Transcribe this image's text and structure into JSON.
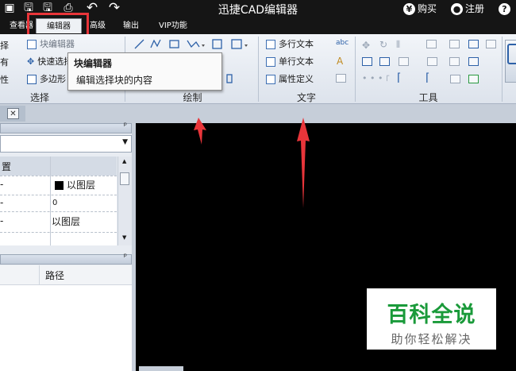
{
  "app": {
    "title": "迅捷CAD编辑器"
  },
  "titlebar": {
    "buy_label": "购买",
    "register_label": "注册",
    "help_glyph": "?",
    "buy_icon": "yen-icon",
    "register_icon": "user-icon"
  },
  "tabs": [
    {
      "label": "查看器"
    },
    {
      "label": "编辑器"
    },
    {
      "label": "高级"
    },
    {
      "label": "输出"
    },
    {
      "label": "VIP功能"
    }
  ],
  "ribbon": {
    "select_group": {
      "label": "选择",
      "items": [
        "择",
        "有",
        "性"
      ],
      "block_items": [
        "块编辑器",
        "快速选择",
        "多边形"
      ]
    },
    "draw_group": {
      "label": "绘制"
    },
    "text_group": {
      "label": "文字",
      "items": [
        "多行文本",
        "单行文本",
        "属性定义"
      ]
    },
    "tools_group": {
      "label": "工具"
    }
  },
  "tooltip": {
    "title": "块编辑器",
    "description": "编辑选择块的内容"
  },
  "left_panel": {
    "properties_header": "置",
    "rows": [
      {
        "name": "",
        "value": "以图层"
      },
      {
        "name": "",
        "value": "0"
      },
      {
        "name": "",
        "value": "以图层"
      }
    ],
    "files_header": "路径"
  },
  "watermark": {
    "title": "百科全说",
    "subtitle": "助你轻松解决"
  },
  "colors": {
    "highlight": "#e8353a",
    "canvas": "#000000",
    "watermark_title": "#1a9a3a"
  }
}
